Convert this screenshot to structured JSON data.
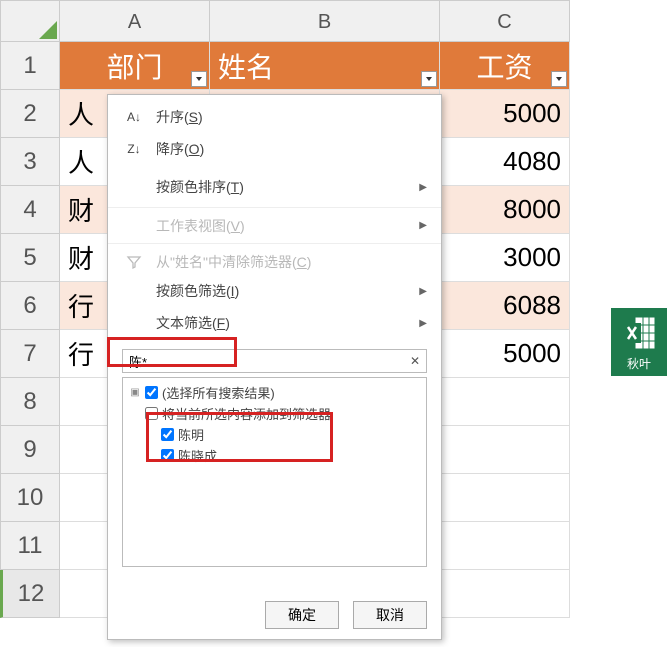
{
  "columns": [
    "A",
    "B",
    "C"
  ],
  "row_numbers": [
    "1",
    "2",
    "3",
    "4",
    "5",
    "6",
    "7",
    "8",
    "9",
    "10",
    "11",
    "12"
  ],
  "headers": {
    "a": "部门",
    "b": "姓名",
    "c": "工资"
  },
  "rows": [
    {
      "a": "人",
      "b": "",
      "c": "5000",
      "stripe": true
    },
    {
      "a": "人",
      "b": "",
      "c": "4080",
      "stripe": false
    },
    {
      "a": "财",
      "b": "",
      "c": "8000",
      "stripe": true
    },
    {
      "a": "财",
      "b": "",
      "c": "3000",
      "stripe": false
    },
    {
      "a": "行",
      "b": "",
      "c": "6088",
      "stripe": true
    },
    {
      "a": "行",
      "b": "",
      "c": "5000",
      "stripe": false
    }
  ],
  "menu": {
    "sort_asc": {
      "label": "升序(",
      "key": "S",
      "suffix": ")"
    },
    "sort_desc": {
      "label": "降序(",
      "key": "O",
      "suffix": ")"
    },
    "sort_color": {
      "label": "按颜色排序(",
      "key": "T",
      "suffix": ")"
    },
    "sheet_view": {
      "label": "工作表视图(",
      "key": "V",
      "suffix": ")"
    },
    "clear_filter": {
      "label": "从\"姓名\"中清除筛选器(",
      "key": "C",
      "suffix": ")"
    },
    "filter_color": {
      "label": "按颜色筛选(",
      "key": "I",
      "suffix": ")"
    },
    "text_filter": {
      "label": "文本筛选(",
      "key": "F",
      "suffix": ")"
    }
  },
  "search": {
    "value": "陈*"
  },
  "tree": {
    "select_all": "(选择所有搜索结果)",
    "add_to_filter": "将当前所选内容添加到筛选器",
    "items": [
      "陈明",
      "陈晓成"
    ]
  },
  "buttons": {
    "ok": "确定",
    "cancel": "取消"
  },
  "watermark": "秋叶"
}
